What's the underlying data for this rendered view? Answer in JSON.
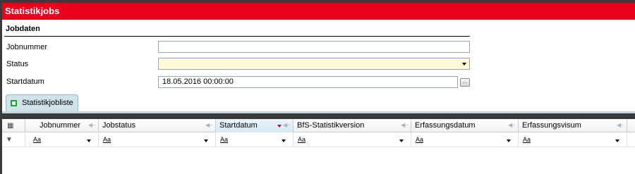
{
  "window": {
    "title": "Statistikjobs"
  },
  "jobdaten": {
    "section_title": "Jobdaten",
    "fields": {
      "jobnummer": {
        "label": "Jobnummer",
        "value": ""
      },
      "status": {
        "label": "Status",
        "value": ""
      },
      "startdatum": {
        "label": "Startdatum",
        "value": "18.05.2016 00:00:00",
        "button_label": "..."
      }
    }
  },
  "tabs": [
    {
      "label": "Statistikjobliste",
      "active": true
    }
  ],
  "grid": {
    "columns": [
      {
        "label": "Jobnummer"
      },
      {
        "label": "Jobstatus"
      },
      {
        "label": "Startdatum",
        "sorted": "descending"
      },
      {
        "label": "BfS-Statistikversion"
      },
      {
        "label": "Erfassungsdatum"
      },
      {
        "label": "Erfassungsvisum"
      }
    ],
    "filter_placeholder": "Aa"
  },
  "colors": {
    "title_bar": "#e8001c",
    "status_field_bg": "#fffbd9",
    "tab_bg": "#cfe3ea",
    "sort_arrow": "#d4001a"
  },
  "icons": {
    "tab": "green-square-icon",
    "grid_corner": "column-chooser-icon",
    "filter_row": "filter-icon",
    "column_pin": "pin-icon",
    "dropdown": "chevron-down-icon"
  }
}
